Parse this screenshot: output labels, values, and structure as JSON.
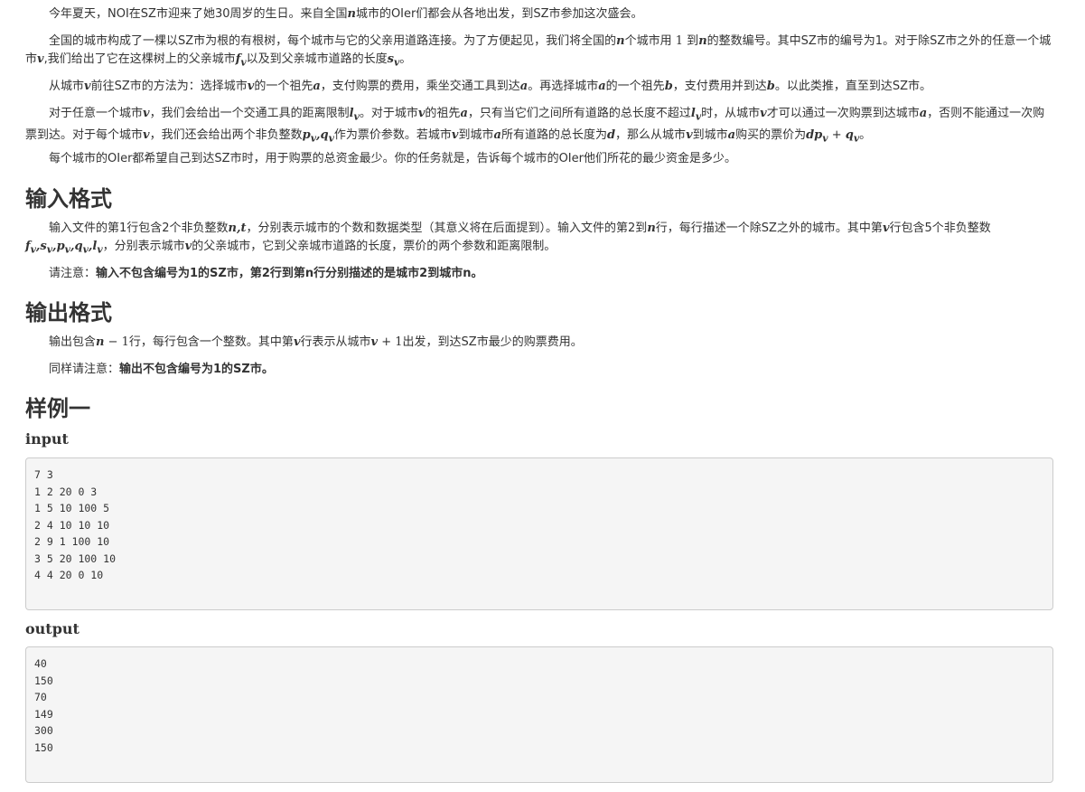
{
  "description": {
    "p1": "今年夏天，NOI在SZ市迎来了她30周岁的生日。来自全国n城市的OIer们都会从各地出发，到SZ市参加这次盛会。",
    "p2": "全国的城市构成了一棵以SZ市为根的有根树，每个城市与它的父亲用道路连接。为了方便起见，我们将全国的n个城市用 1 到n的整数编号。其中SZ市的编号为1。对于除SZ市之外的任意一个城市v,我们给出了它在这棵树上的父亲城市f_v以及到父亲城市道路的长度s_v。",
    "p3": "从城市v前往SZ市的方法为：选择城市v的一个祖先a，支付购票的费用，乘坐交通工具到达a。再选择城市a的一个祖先b，支付费用并到达b。以此类推，直至到达SZ市。",
    "p4": "对于任意一个城市v，我们会给出一个交通工具的距离限制l_v。对于城市v的祖先a，只有当它们之间所有道路的总长度不超过l_v时，从城市v才可以通过一次购票到达城市a，否则不能通过一次购票到达。对于每个城市v，我们还会给出两个非负整数p_v,q_v作为票价参数。若城市v到城市a所有道路的总长度为d，那么从城市v到城市a购买的票价为dp_v+q_v。",
    "p5": "每个城市的OIer都希望自己到达SZ市时，用于购票的总资金最少。你的任务就是，告诉每个城市的OIer他们所花的最少资金是多少。"
  },
  "input_format": {
    "heading": "输入格式",
    "p1": "输入文件的第1行包含2个非负整数n,t，分别表示城市的个数和数据类型（其意义将在后面提到）。输入文件的第2到n行，每行描述一个除SZ之外的城市。其中第v行包含5个非负整数f_v,s_v,p_v,q_v,l_v，分别表示城市v的父亲城市，它到父亲城市道路的长度，票价的两个参数和距离限制。",
    "note_prefix": "请注意：",
    "note_bold": "输入不包含编号为1的SZ市，第2行到第n行分别描述的是城市2到城市n。"
  },
  "output_format": {
    "heading": "输出格式",
    "p1": "输出包含n−1行，每行包含一个整数。其中第v行表示从城市v+1出发，到达SZ市最少的购票费用。",
    "note_prefix": "同样请注意：",
    "note_bold": "输出不包含编号为1的SZ市。"
  },
  "sample": {
    "heading": "样例一",
    "input_label": "input",
    "input_text": "7 3\n1 2 20 0 3\n1 5 10 100 5\n2 4 10 10 10\n2 9 1 100 10\n3 5 20 100 10\n4 4 20 0 10",
    "output_label": "output",
    "output_text": "40\n150\n70\n149\n300\n150"
  }
}
